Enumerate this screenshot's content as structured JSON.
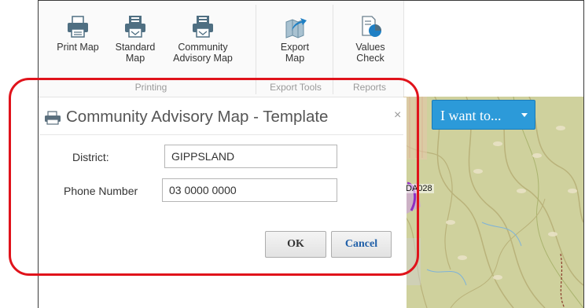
{
  "ribbon": {
    "buttons": [
      {
        "label1": "Print Map",
        "label2": ""
      },
      {
        "label1": "Standard",
        "label2": "Map"
      },
      {
        "label1": "Community",
        "label2": "Advisory Map"
      },
      {
        "label1": "Export",
        "label2": "Map"
      },
      {
        "label1": "Values",
        "label2": "Check"
      }
    ],
    "groups": [
      "Printing",
      "Export Tools",
      "Reports"
    ]
  },
  "dialog": {
    "title": "Community Advisory Map - Template",
    "close": "×",
    "district_label": "District:",
    "district_value": "GIPPSLAND",
    "phone_label": "Phone Number",
    "phone_value": "03 0000 0000",
    "ok": "OK",
    "cancel": "Cancel"
  },
  "map": {
    "i_want_to": "I want to...",
    "label": "DA028"
  },
  "colors": {
    "accent": "#2c9ad9",
    "highlight": "#e0131b",
    "cancel_text": "#1f5fa8"
  },
  "icons": [
    "printer-icon",
    "print-template-icon",
    "export-map-icon",
    "values-check-icon",
    "dialog-printer-icon",
    "caret-down-icon"
  ]
}
